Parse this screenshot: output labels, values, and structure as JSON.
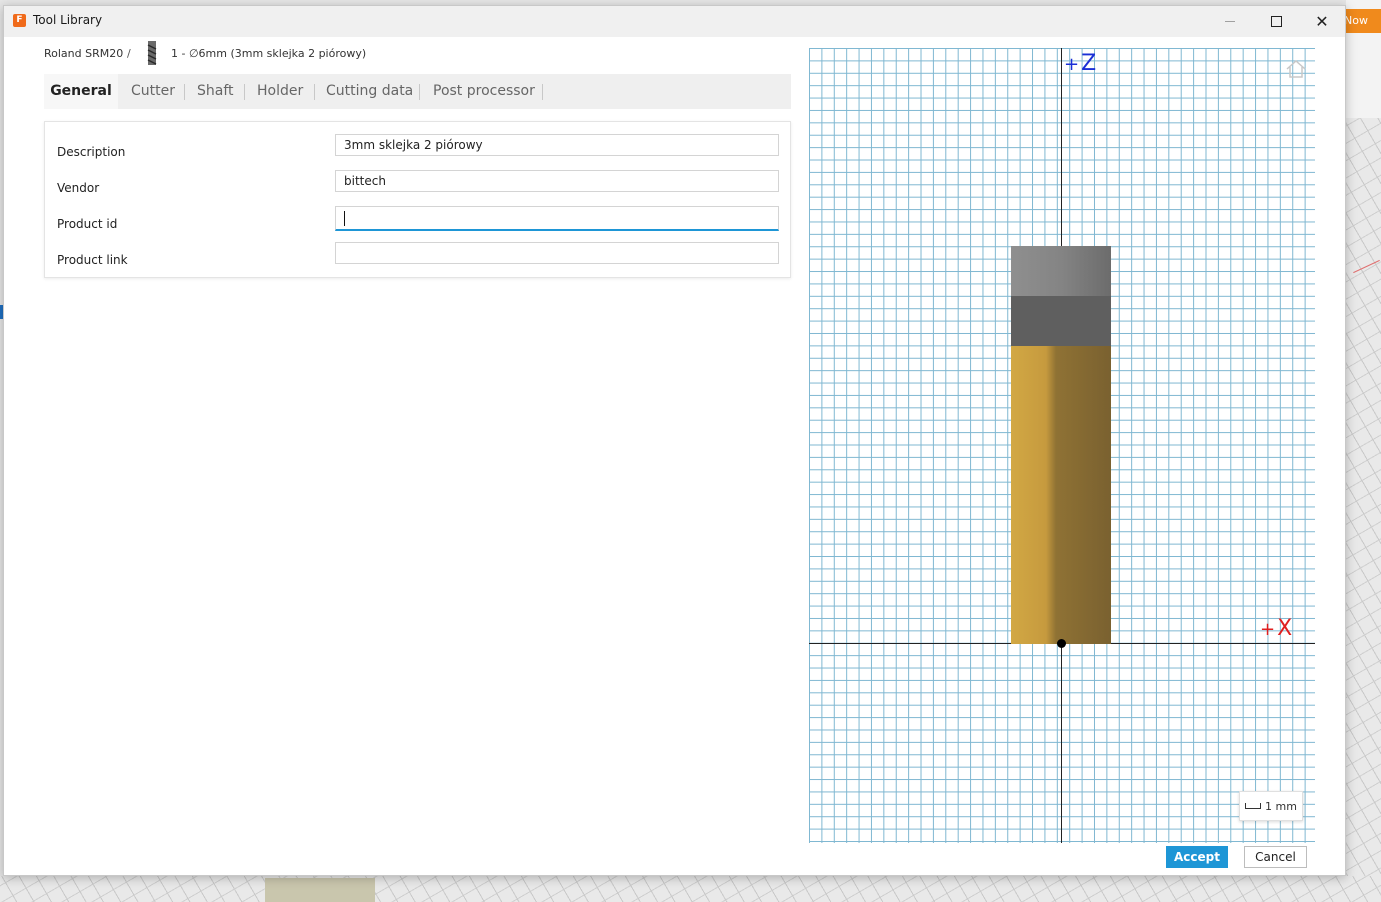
{
  "window": {
    "title": "Tool Library",
    "app_icon_letter": "F"
  },
  "background": {
    "now_button_label": "Now"
  },
  "breadcrumb": {
    "root": "Roland SRM20",
    "separator": "/",
    "tool": "1 - ∅6mm (3mm sklejka 2 piórowy)"
  },
  "tabs": [
    {
      "label": "General",
      "active": true
    },
    {
      "label": "Cutter"
    },
    {
      "label": "Shaft"
    },
    {
      "label": "Holder"
    },
    {
      "label": "Cutting data"
    },
    {
      "label": "Post processor"
    }
  ],
  "form": {
    "rows": [
      {
        "label": "Description",
        "value": "3mm sklejka 2 piórowy"
      },
      {
        "label": "Vendor",
        "value": "bittech"
      },
      {
        "label": "Product id",
        "value": "",
        "focused": true
      },
      {
        "label": "Product link",
        "value": ""
      }
    ]
  },
  "preview": {
    "z_axis_label": "Z",
    "x_axis_label": "X",
    "plus": "+",
    "scale_label": "1 mm",
    "colors": {
      "grid": "#7fb7d1",
      "z_axis": "#1a2fd6",
      "x_axis": "#e02020",
      "holder_light": "#8a8a8a",
      "holder_dark": "#5e5e5e",
      "cutter_light": "#d2a844",
      "cutter_dark": "#7a6130"
    }
  },
  "footer": {
    "accept_label": "Accept",
    "cancel_label": "Cancel",
    "accept_color": "#1e96d6"
  }
}
